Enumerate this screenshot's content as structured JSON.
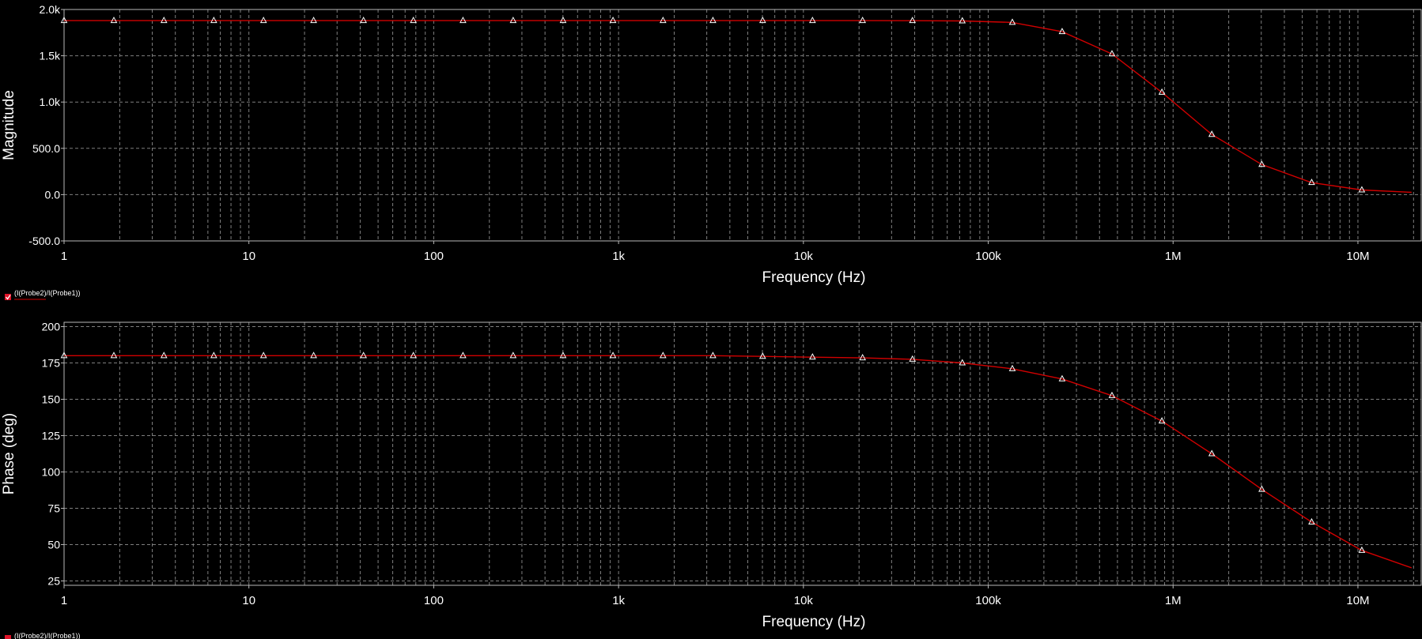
{
  "colors": {
    "background": "#000000",
    "grid": "#7f7f7f",
    "frame": "#b8b8b8",
    "trace": "#d10000",
    "marker": "#ffffff",
    "legend_check": "#e0142a"
  },
  "legend_label": "(I(Probe2)/I(Probe1))",
  "chart_data": [
    {
      "type": "line",
      "name": "magnitude-plot",
      "xlabel": "Frequency (Hz)",
      "ylabel": "Magnitude",
      "xscale": "log",
      "xlim": [
        1,
        22000000
      ],
      "ylim": [
        -500,
        2000
      ],
      "xticks": [
        {
          "value": 1,
          "label": "1"
        },
        {
          "value": 10,
          "label": "10"
        },
        {
          "value": 100,
          "label": "100"
        },
        {
          "value": 1000,
          "label": "1k"
        },
        {
          "value": 10000,
          "label": "10k"
        },
        {
          "value": 100000,
          "label": "100k"
        },
        {
          "value": 1000000,
          "label": "1M"
        },
        {
          "value": 10000000,
          "label": "10M"
        }
      ],
      "yticks": [
        {
          "value": 2000,
          "label": "2.0k"
        },
        {
          "value": 1500,
          "label": "1.5k"
        },
        {
          "value": 1000,
          "label": "1.0k"
        },
        {
          "value": 500,
          "label": "500.0"
        },
        {
          "value": 0,
          "label": "0.0"
        },
        {
          "value": -500,
          "label": "-500.0"
        }
      ],
      "grid": true,
      "series": [
        {
          "x": [
            1,
            1.86,
            3.47,
            6.46,
            12,
            22.4,
            41.7,
            77.6,
            144,
            269,
            501,
            933,
            1740,
            3240,
            6020,
            11200,
            20900,
            38900,
            72400,
            135000,
            251000,
            467000,
            870000,
            1620000,
            3020000,
            5620000,
            10500000,
            19500000
          ],
          "y": [
            1880,
            1880,
            1880,
            1880,
            1880,
            1880,
            1880,
            1880,
            1880,
            1880,
            1880,
            1880,
            1880,
            1880,
            1880,
            1880,
            1880,
            1879,
            1876,
            1860,
            1760,
            1520,
            1105,
            650,
            325,
            130,
            50,
            25
          ]
        }
      ],
      "markers_x": [
        1,
        1.86,
        3.47,
        6.46,
        12,
        22.4,
        41.7,
        77.6,
        144,
        269,
        501,
        933,
        1740,
        3240,
        6020,
        11200,
        20900,
        38900,
        72400,
        135000,
        251000,
        467000,
        870000,
        1620000,
        3020000,
        5620000,
        10500000
      ]
    },
    {
      "type": "line",
      "name": "phase-plot",
      "xlabel": "Frequency (Hz)",
      "ylabel": "Phase (deg)",
      "xscale": "log",
      "xlim": [
        1,
        22000000
      ],
      "ylim": [
        22,
        203
      ],
      "xticks": [
        {
          "value": 1,
          "label": "1"
        },
        {
          "value": 10,
          "label": "10"
        },
        {
          "value": 100,
          "label": "100"
        },
        {
          "value": 1000,
          "label": "1k"
        },
        {
          "value": 10000,
          "label": "10k"
        },
        {
          "value": 100000,
          "label": "100k"
        },
        {
          "value": 1000000,
          "label": "1M"
        },
        {
          "value": 10000000,
          "label": "10M"
        }
      ],
      "yticks": [
        {
          "value": 200,
          "label": "200"
        },
        {
          "value": 175,
          "label": "175"
        },
        {
          "value": 150,
          "label": "150"
        },
        {
          "value": 125,
          "label": "125"
        },
        {
          "value": 100,
          "label": "100"
        },
        {
          "value": 75,
          "label": "75"
        },
        {
          "value": 50,
          "label": "50"
        },
        {
          "value": 25,
          "label": "25"
        }
      ],
      "grid": true,
      "series": [
        {
          "x": [
            1,
            1.86,
            3.47,
            6.46,
            12,
            22.4,
            41.7,
            77.6,
            144,
            269,
            501,
            933,
            1740,
            3240,
            6020,
            11200,
            20900,
            38900,
            72400,
            135000,
            251000,
            467000,
            870000,
            1620000,
            3020000,
            5620000,
            10500000,
            19500000
          ],
          "y": [
            180,
            180,
            180,
            180,
            180,
            180,
            180,
            180,
            180,
            180,
            180,
            180,
            180,
            180,
            179.5,
            179,
            178.5,
            177.5,
            175,
            171,
            164,
            152.5,
            135,
            112.5,
            88,
            65.5,
            46,
            34
          ]
        }
      ],
      "markers_x": [
        1,
        1.86,
        3.47,
        6.46,
        12,
        22.4,
        41.7,
        77.6,
        144,
        269,
        501,
        933,
        1740,
        3240,
        6020,
        11200,
        20900,
        38900,
        72400,
        135000,
        251000,
        467000,
        870000,
        1620000,
        3020000,
        5620000,
        10500000
      ]
    }
  ]
}
